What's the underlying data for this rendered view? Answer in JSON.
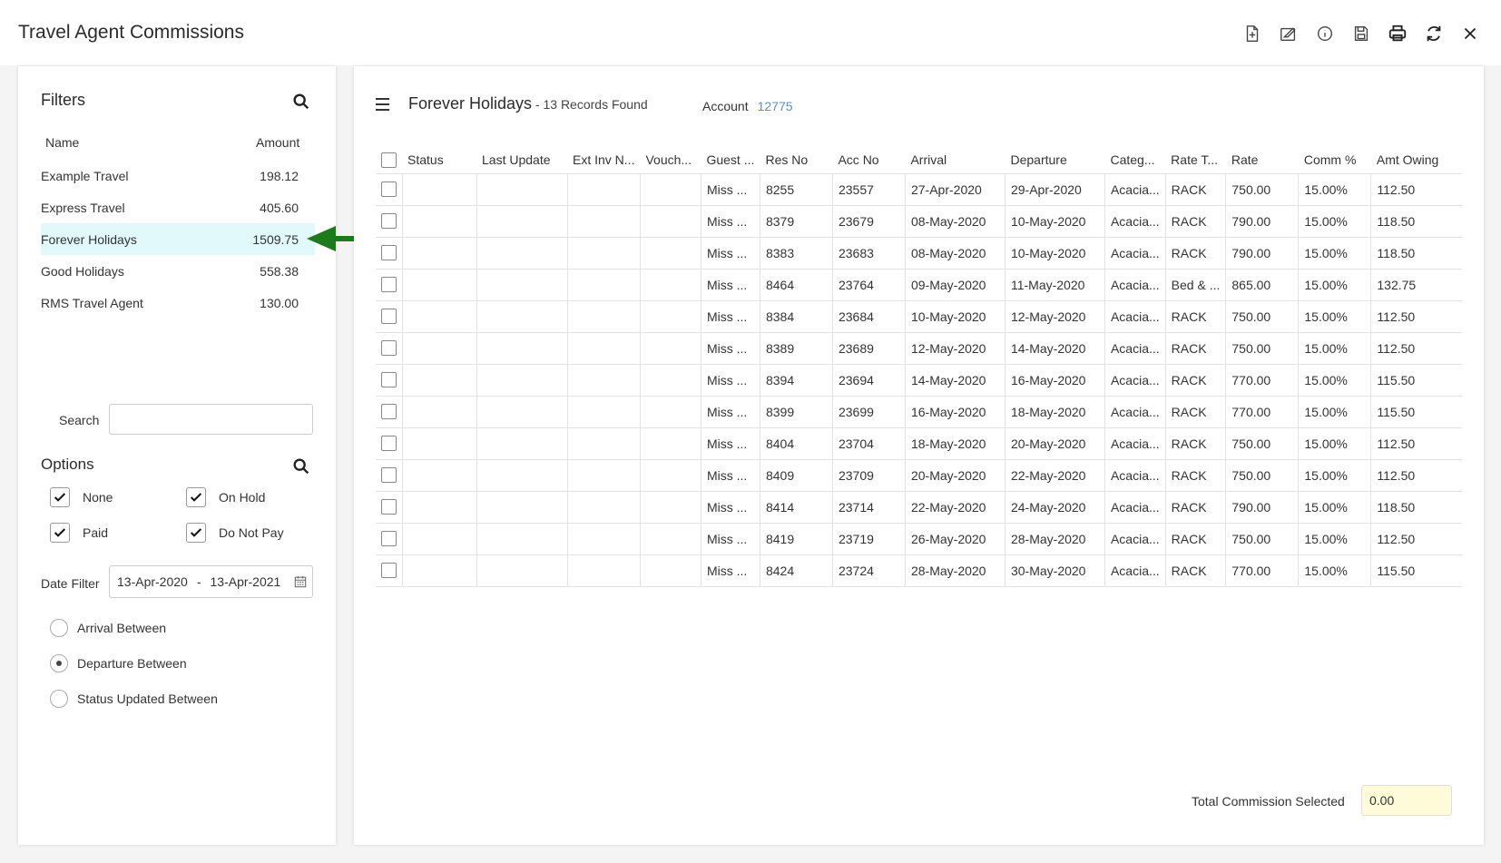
{
  "app": {
    "title": "Travel Agent Commissions"
  },
  "toolbar": {
    "icons": [
      "new-document-icon",
      "edit-icon",
      "info-icon",
      "save-icon",
      "print-icon",
      "refresh-icon",
      "close-icon"
    ]
  },
  "filters": {
    "title": "Filters",
    "col_name": "Name",
    "col_amount": "Amount",
    "agents": [
      {
        "name": "Example Travel",
        "amount": "198.12"
      },
      {
        "name": "Express Travel",
        "amount": "405.60"
      },
      {
        "name": "Forever Holidays",
        "amount": "1509.75"
      },
      {
        "name": "Good Holidays",
        "amount": "558.38"
      },
      {
        "name": "RMS Travel Agent",
        "amount": "130.00"
      }
    ],
    "selected_agent": "Forever Holidays",
    "search_label": "Search",
    "search_value": ""
  },
  "options": {
    "title": "Options",
    "none": "None",
    "on_hold": "On Hold",
    "paid": "Paid",
    "do_not_pay": "Do Not Pay",
    "date_filter_label": "Date Filter",
    "date_from": "13-Apr-2020",
    "date_sep": "-",
    "date_to": "13-Apr-2021",
    "radio_arrival": "Arrival Between",
    "radio_departure": "Departure Between",
    "radio_status": "Status Updated Between",
    "radio_selected": "Departure Between"
  },
  "grid": {
    "title": "Forever Holidays",
    "count": " - 13 Records Found",
    "account_label": "Account",
    "account_value": "12775",
    "columns": [
      "Status",
      "Last Update",
      "Ext Inv N...",
      "Vouch...",
      "Guest ...",
      "Res No",
      "Acc No",
      "Arrival",
      "Departure",
      "Categ...",
      "Rate T...",
      "Rate",
      "Comm %",
      "Amt Owing"
    ],
    "rows": [
      {
        "guest": "Miss ...",
        "res": "8255",
        "acc": "23557",
        "arrival": "27-Apr-2020",
        "departure": "29-Apr-2020",
        "category": "Acacia...",
        "rate_type": "RACK",
        "rate": "750.00",
        "comm": "15.00%",
        "owing": "112.50"
      },
      {
        "guest": "Miss ...",
        "res": "8379",
        "acc": "23679",
        "arrival": "08-May-2020",
        "departure": "10-May-2020",
        "category": "Acacia...",
        "rate_type": "RACK",
        "rate": "790.00",
        "comm": "15.00%",
        "owing": "118.50"
      },
      {
        "guest": "Miss ...",
        "res": "8383",
        "acc": "23683",
        "arrival": "08-May-2020",
        "departure": "10-May-2020",
        "category": "Acacia...",
        "rate_type": "RACK",
        "rate": "790.00",
        "comm": "15.00%",
        "owing": "118.50"
      },
      {
        "guest": "Miss ...",
        "res": "8464",
        "acc": "23764",
        "arrival": "09-May-2020",
        "departure": "11-May-2020",
        "category": "Acacia...",
        "rate_type": "Bed & ...",
        "rate": "865.00",
        "comm": "15.00%",
        "owing": "132.75"
      },
      {
        "guest": "Miss ...",
        "res": "8384",
        "acc": "23684",
        "arrival": "10-May-2020",
        "departure": "12-May-2020",
        "category": "Acacia...",
        "rate_type": "RACK",
        "rate": "750.00",
        "comm": "15.00%",
        "owing": "112.50"
      },
      {
        "guest": "Miss ...",
        "res": "8389",
        "acc": "23689",
        "arrival": "12-May-2020",
        "departure": "14-May-2020",
        "category": "Acacia...",
        "rate_type": "RACK",
        "rate": "750.00",
        "comm": "15.00%",
        "owing": "112.50"
      },
      {
        "guest": "Miss ...",
        "res": "8394",
        "acc": "23694",
        "arrival": "14-May-2020",
        "departure": "16-May-2020",
        "category": "Acacia...",
        "rate_type": "RACK",
        "rate": "770.00",
        "comm": "15.00%",
        "owing": "115.50"
      },
      {
        "guest": "Miss ...",
        "res": "8399",
        "acc": "23699",
        "arrival": "16-May-2020",
        "departure": "18-May-2020",
        "category": "Acacia...",
        "rate_type": "RACK",
        "rate": "770.00",
        "comm": "15.00%",
        "owing": "115.50"
      },
      {
        "guest": "Miss ...",
        "res": "8404",
        "acc": "23704",
        "arrival": "18-May-2020",
        "departure": "20-May-2020",
        "category": "Acacia...",
        "rate_type": "RACK",
        "rate": "750.00",
        "comm": "15.00%",
        "owing": "112.50"
      },
      {
        "guest": "Miss ...",
        "res": "8409",
        "acc": "23709",
        "arrival": "20-May-2020",
        "departure": "22-May-2020",
        "category": "Acacia...",
        "rate_type": "RACK",
        "rate": "750.00",
        "comm": "15.00%",
        "owing": "112.50"
      },
      {
        "guest": "Miss ...",
        "res": "8414",
        "acc": "23714",
        "arrival": "22-May-2020",
        "departure": "24-May-2020",
        "category": "Acacia...",
        "rate_type": "RACK",
        "rate": "790.00",
        "comm": "15.00%",
        "owing": "118.50"
      },
      {
        "guest": "Miss ...",
        "res": "8419",
        "acc": "23719",
        "arrival": "26-May-2020",
        "departure": "28-May-2020",
        "category": "Acacia...",
        "rate_type": "RACK",
        "rate": "750.00",
        "comm": "15.00%",
        "owing": "112.50"
      },
      {
        "guest": "Miss ...",
        "res": "8424",
        "acc": "23724",
        "arrival": "28-May-2020",
        "departure": "30-May-2020",
        "category": "Acacia...",
        "rate_type": "RACK",
        "rate": "770.00",
        "comm": "15.00%",
        "owing": "115.50"
      }
    ],
    "total_label": "Total Commission Selected",
    "total_value": "0.00"
  },
  "colors": {
    "link": "#5c8fc2",
    "selected_row": "#e1f9fb",
    "annotation_arrow": "#1d7a1d",
    "total_bg": "#fdfbd8"
  }
}
